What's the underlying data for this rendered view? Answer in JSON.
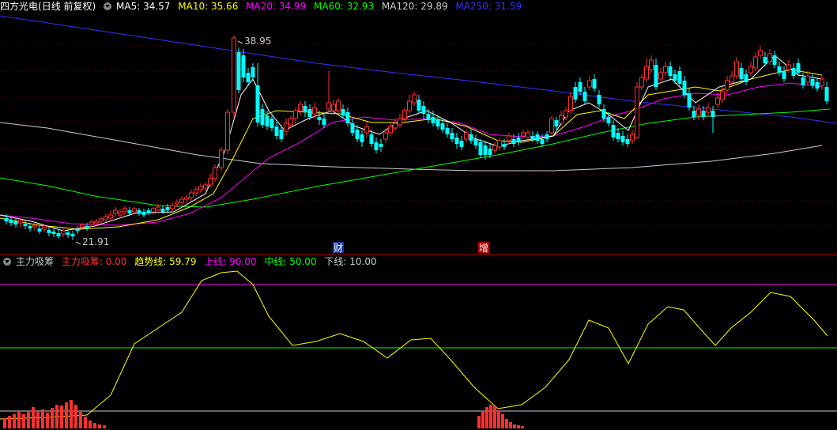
{
  "main_header": {
    "title": "四方光电",
    "mode": "(日线 前复权)",
    "ma": [
      {
        "label": "MA5: 34.57",
        "color": "#ffffff"
      },
      {
        "label": "MA10: 35.66",
        "color": "#ffff00"
      },
      {
        "label": "MA20: 34.99",
        "color": "#ff00ff"
      },
      {
        "label": "MA60: 32.93",
        "color": "#00ff00"
      },
      {
        "label": "MA120: 29.89",
        "color": "#cccccc"
      },
      {
        "label": "MA250: 31.59",
        "color": "#3333ff"
      }
    ]
  },
  "price_labels": {
    "high": "38.95",
    "low": "21.91"
  },
  "event_markers": [
    {
      "text": "财",
      "color": "#ffffff",
      "bg": "#1a3a9a"
    },
    {
      "text": "增",
      "color": "#ffffff",
      "bg": "#b00000"
    }
  ],
  "indicator_header": {
    "name": "主力吸筹",
    "items": [
      {
        "label": "主力吸筹: 0.00",
        "color": "#ff3030"
      },
      {
        "label": "趋势线: 59.79",
        "color": "#ffff00"
      },
      {
        "label": "上线: 90.00",
        "color": "#ff00ff"
      },
      {
        "label": "中线: 50.00",
        "color": "#00ff00"
      },
      {
        "label": "下线: 10.00",
        "color": "#cccccc"
      }
    ]
  },
  "colors": {
    "up": "#ff3030",
    "down": "#00ffff",
    "grid": "#7a0000",
    "border": "#b00000",
    "ma5": "#ffffff",
    "ma10": "#ffff00",
    "ma20": "#ff00ff",
    "ma60": "#00ff00",
    "ma120": "#cccccc",
    "ma250": "#3333ff"
  },
  "chart_data": [
    {
      "type": "candlestick",
      "title": "四方光电 (日线 前复权)",
      "high": 38.95,
      "low": 21.91,
      "series": [
        "MA5",
        "MA10",
        "MA20",
        "MA60",
        "MA120",
        "MA250"
      ],
      "latest": {
        "MA5": 34.57,
        "MA10": 35.66,
        "MA20": 34.99,
        "MA60": 32.93,
        "MA120": 29.89,
        "MA250": 31.59
      }
    },
    {
      "type": "line",
      "title": "主力吸筹",
      "series": [
        {
          "name": "趋势线",
          "latest": 59.79
        },
        {
          "name": "上线",
          "value": 90.0
        },
        {
          "name": "中线",
          "value": 50.0
        },
        {
          "name": "下线",
          "value": 10.0
        },
        {
          "name": "主力吸筹",
          "latest": 0.0
        }
      ]
    }
  ]
}
